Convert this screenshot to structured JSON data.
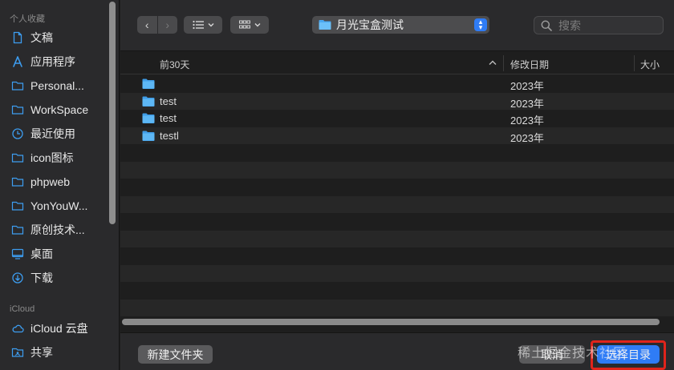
{
  "sidebar": {
    "favorites_heading": "个人收藏",
    "favorites": [
      {
        "label": "文稿",
        "icon": "document-icon"
      },
      {
        "label": "应用程序",
        "icon": "applications-icon"
      },
      {
        "label": "Personal...",
        "icon": "folder-icon"
      },
      {
        "label": "WorkSpace",
        "icon": "folder-icon"
      },
      {
        "label": "最近使用",
        "icon": "clock-icon"
      },
      {
        "label": "icon图标",
        "icon": "folder-icon"
      },
      {
        "label": "phpweb",
        "icon": "folder-icon"
      },
      {
        "label": "YonYouW...",
        "icon": "folder-icon"
      },
      {
        "label": "原创技术...",
        "icon": "folder-icon"
      },
      {
        "label": "桌面",
        "icon": "desktop-icon"
      },
      {
        "label": "下载",
        "icon": "download-icon"
      }
    ],
    "icloud_heading": "iCloud",
    "icloud": [
      {
        "label": "iCloud 云盘",
        "icon": "cloud-icon"
      },
      {
        "label": "共享",
        "icon": "shared-folder-icon"
      }
    ]
  },
  "toolbar": {
    "back": "‹",
    "forward": "›",
    "current_folder": "月光宝盒测试",
    "search_placeholder": "搜索"
  },
  "columns": {
    "name": "前30天",
    "modified": "修改日期",
    "size": "大小"
  },
  "files": [
    {
      "name": "",
      "date": "2023年"
    },
    {
      "name": "test",
      "date": "2023年"
    },
    {
      "name": "test",
      "date": "2023年"
    },
    {
      "name": "testl",
      "date": "2023年"
    }
  ],
  "bottom": {
    "new_folder": "新建文件夹",
    "cancel": "取消",
    "choose": "选择目录",
    "watermark": "稀土掘金技术社区"
  },
  "colors": {
    "accent": "#2f7cf6",
    "folder": "#4aa8f0",
    "highlight": "#e0241b"
  }
}
